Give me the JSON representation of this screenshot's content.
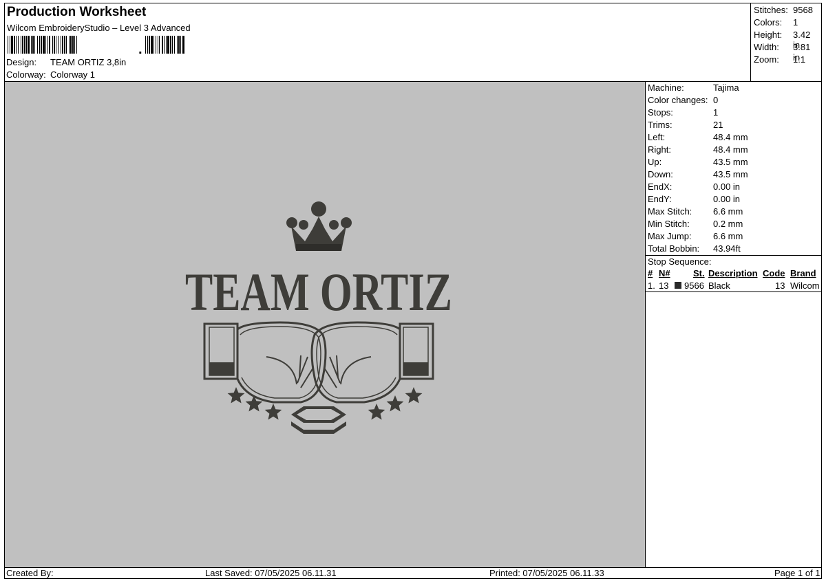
{
  "header": {
    "title": "Production Worksheet",
    "subtitle": "Wilcom EmbroideryStudio – Level 3 Advanced",
    "design_label": "Design:",
    "design_value": "TEAM ORTIZ 3,8in",
    "colorway_label": "Colorway:",
    "colorway_value": "Colorway 1"
  },
  "summary": [
    {
      "label": "Stitches:",
      "value": "9568"
    },
    {
      "label": "Colors:",
      "value": "1"
    },
    {
      "label": "Height:",
      "value": "3.42 in"
    },
    {
      "label": "Width:",
      "value": "3.81 in"
    },
    {
      "label": "Zoom:",
      "value": "1:1"
    }
  ],
  "info": [
    {
      "label": "Machine:",
      "value": "Tajima"
    },
    {
      "label": "Color changes:",
      "value": "0"
    },
    {
      "label": "Stops:",
      "value": "1"
    },
    {
      "label": "Trims:",
      "value": "21"
    },
    {
      "label": "Left:",
      "value": "48.4 mm"
    },
    {
      "label": "Right:",
      "value": "48.4 mm"
    },
    {
      "label": "Up:",
      "value": "43.5 mm"
    },
    {
      "label": "Down:",
      "value": "43.5 mm"
    },
    {
      "label": "EndX:",
      "value": "0.00 in"
    },
    {
      "label": "EndY:",
      "value": "0.00 in"
    },
    {
      "label": "Max Stitch:",
      "value": "6.6 mm"
    },
    {
      "label": "Min Stitch:",
      "value": "0.2 mm"
    },
    {
      "label": "Max Jump:",
      "value": "6.6 mm"
    },
    {
      "label": "Total Bobbin:",
      "value": "43.94ft"
    }
  ],
  "stop_sequence": {
    "title": "Stop Sequence:",
    "headers": [
      "#",
      "N#",
      "St.",
      "Description",
      "Code",
      "Brand"
    ],
    "rows": [
      {
        "num": "1.",
        "n": "13",
        "color": "#2a2a2a",
        "st": "9566",
        "description": "Black",
        "code": "13",
        "brand": "Wilcom"
      }
    ]
  },
  "design": {
    "text": "TEAM ORTIZ",
    "thread_color": "#3e3d39",
    "canvas_color": "#c0c0c0"
  },
  "footer": {
    "created_by": "Created By:",
    "last_saved": "Last Saved: 07/05/2025 06.11.31",
    "printed": "Printed: 07/05/2025 06.11.33",
    "page": "Page 1 of 1"
  }
}
